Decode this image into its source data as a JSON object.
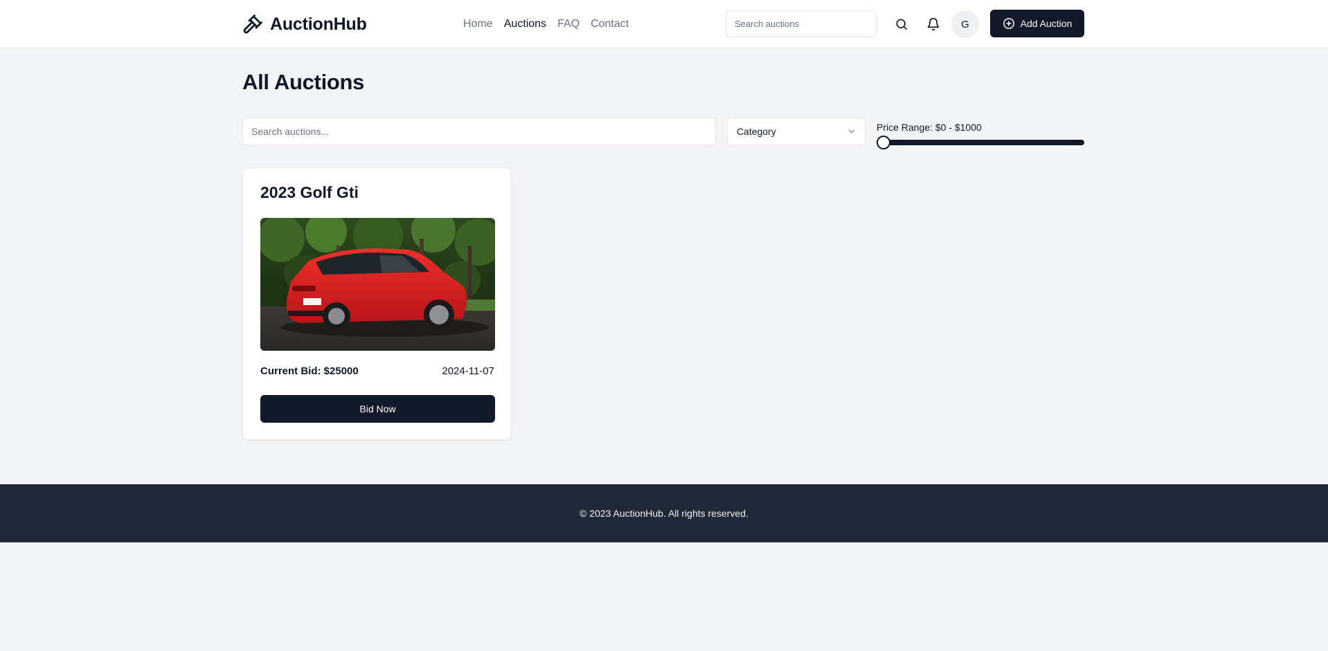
{
  "header": {
    "brand": "AuctionHub",
    "nav": [
      {
        "label": "Home",
        "active": false
      },
      {
        "label": "Auctions",
        "active": true
      },
      {
        "label": "FAQ",
        "active": false
      },
      {
        "label": "Contact",
        "active": false
      }
    ],
    "search_placeholder": "Search auctions",
    "search_icon": "search-icon",
    "notification_icon": "bell-icon",
    "avatar_initial": "G",
    "add_button_label": "Add Auction",
    "add_button_icon": "plus-circle-icon"
  },
  "main": {
    "title": "All Auctions",
    "filters": {
      "search_placeholder": "Search auctions...",
      "category_label": "Category",
      "price_range_label": "Price Range: $0 - $1000",
      "price_min": 0,
      "price_max": 1000,
      "price_current_fraction": 0
    },
    "auctions": [
      {
        "title": "2023 Golf Gti",
        "current_bid_label": "Current Bid: $25000",
        "date": "2024-11-07",
        "bid_button_label": "Bid Now"
      }
    ]
  },
  "footer": {
    "text": "© 2023 AuctionHub. All rights reserved."
  },
  "colors": {
    "primary": "#111827",
    "background": "#f3f4f6",
    "footer_bg": "#1f2937",
    "muted_text": "#6b7280"
  }
}
